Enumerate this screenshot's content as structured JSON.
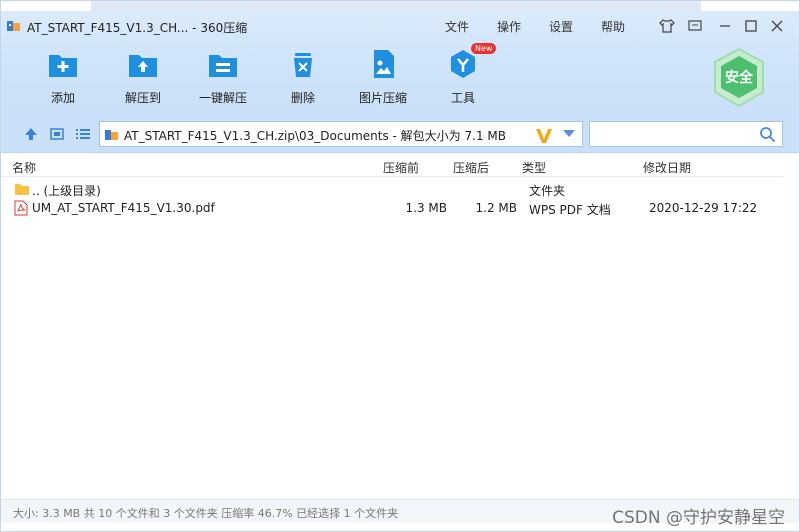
{
  "window": {
    "title": "AT_START_F415_V1.3_CH... - 360压缩",
    "menu": [
      "文件",
      "操作",
      "设置",
      "帮助"
    ]
  },
  "toolbar": {
    "tools": [
      {
        "label": "添加",
        "icon": "add-icon"
      },
      {
        "label": "解压到",
        "icon": "extract-to-icon"
      },
      {
        "label": "一键解压",
        "icon": "one-click-extract-icon"
      },
      {
        "label": "删除",
        "icon": "delete-icon"
      },
      {
        "label": "图片压缩",
        "icon": "image-compress-icon"
      },
      {
        "label": "工具",
        "icon": "tools-icon",
        "badge": "New"
      }
    ],
    "safe_label": "安全"
  },
  "address": {
    "path": "AT_START_F415_V1.3_CH.zip\\03_Documents - 解包大小为 7.1 MB",
    "search_placeholder": ""
  },
  "columns": {
    "name": "名称",
    "compressed_before": "压缩前",
    "compressed_after": "压缩后",
    "type": "类型",
    "modified": "修改日期"
  },
  "files": [
    {
      "name": ".. (上级目录)",
      "before": "",
      "after": "",
      "type": "文件夹",
      "modified": "",
      "icon": "folder-icon"
    },
    {
      "name": "UM_AT_START_F415_V1.30.pdf",
      "before": "1.3 MB",
      "after": "1.2 MB",
      "type": "WPS PDF 文档",
      "modified": "2020-12-29 17:22",
      "icon": "pdf-icon"
    }
  ],
  "status": {
    "text": "大小: 3.3 MB 共 10 个文件和 3 个文件夹 压缩率 46.7% 已经选择 1 个文件夹"
  },
  "watermark": "CSDN @守护安静星空",
  "colors": {
    "accent_blue": "#1f8fe0",
    "safe_green": "#4cc06e",
    "pdf_red": "#d93b2b",
    "folder_yellow": "#f5c342"
  }
}
